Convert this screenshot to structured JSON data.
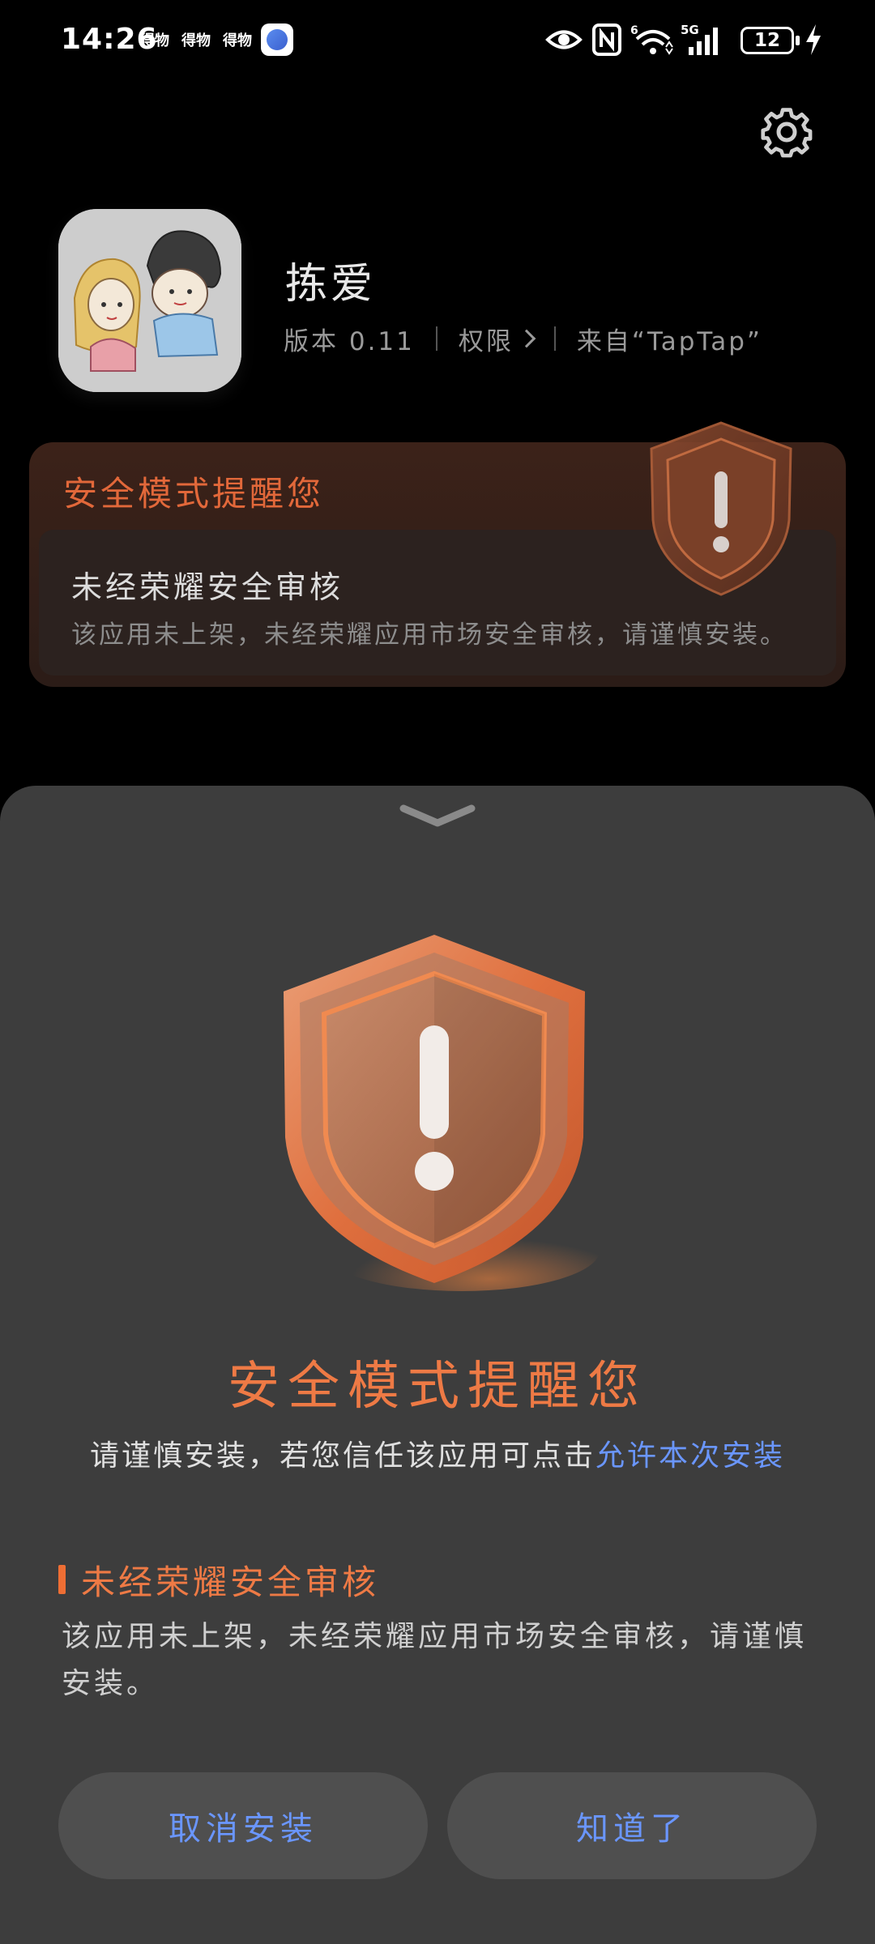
{
  "status_bar": {
    "time": "14:26",
    "notifications": [
      "得物",
      "得物",
      "得物"
    ],
    "battery": "12"
  },
  "app": {
    "name": "拣爱",
    "version": "版本 0.11",
    "permissions": "权限",
    "source": "来自“TapTap”"
  },
  "safety_card": {
    "title": "安全模式提醒您",
    "inner_title": "未经荣耀安全审核",
    "inner_desc": "该应用未上架，未经荣耀应用市场安全审核，请谨慎安装。"
  },
  "sheet": {
    "title": "安全模式提醒您",
    "subtitle_prefix": "请谨慎安装，若您信任该应用可点击",
    "subtitle_link": "允许本次安装",
    "section_title": "未经荣耀安全审核",
    "section_desc": "该应用未上架，未经荣耀应用市场安全审核，请谨慎安装。",
    "cancel_label": "取消安装",
    "ok_label": "知道了"
  },
  "colors": {
    "accent_orange": "#ee7a45",
    "link_blue": "#6a96ff",
    "sheet_bg": "#3d3d3d"
  },
  "icons": [
    "settings-gear-icon",
    "eye-icon",
    "nfc-icon",
    "wifi-icon",
    "signal-icon",
    "battery-icon",
    "charging-icon",
    "shield-warning-icon",
    "chevron-down-icon"
  ]
}
